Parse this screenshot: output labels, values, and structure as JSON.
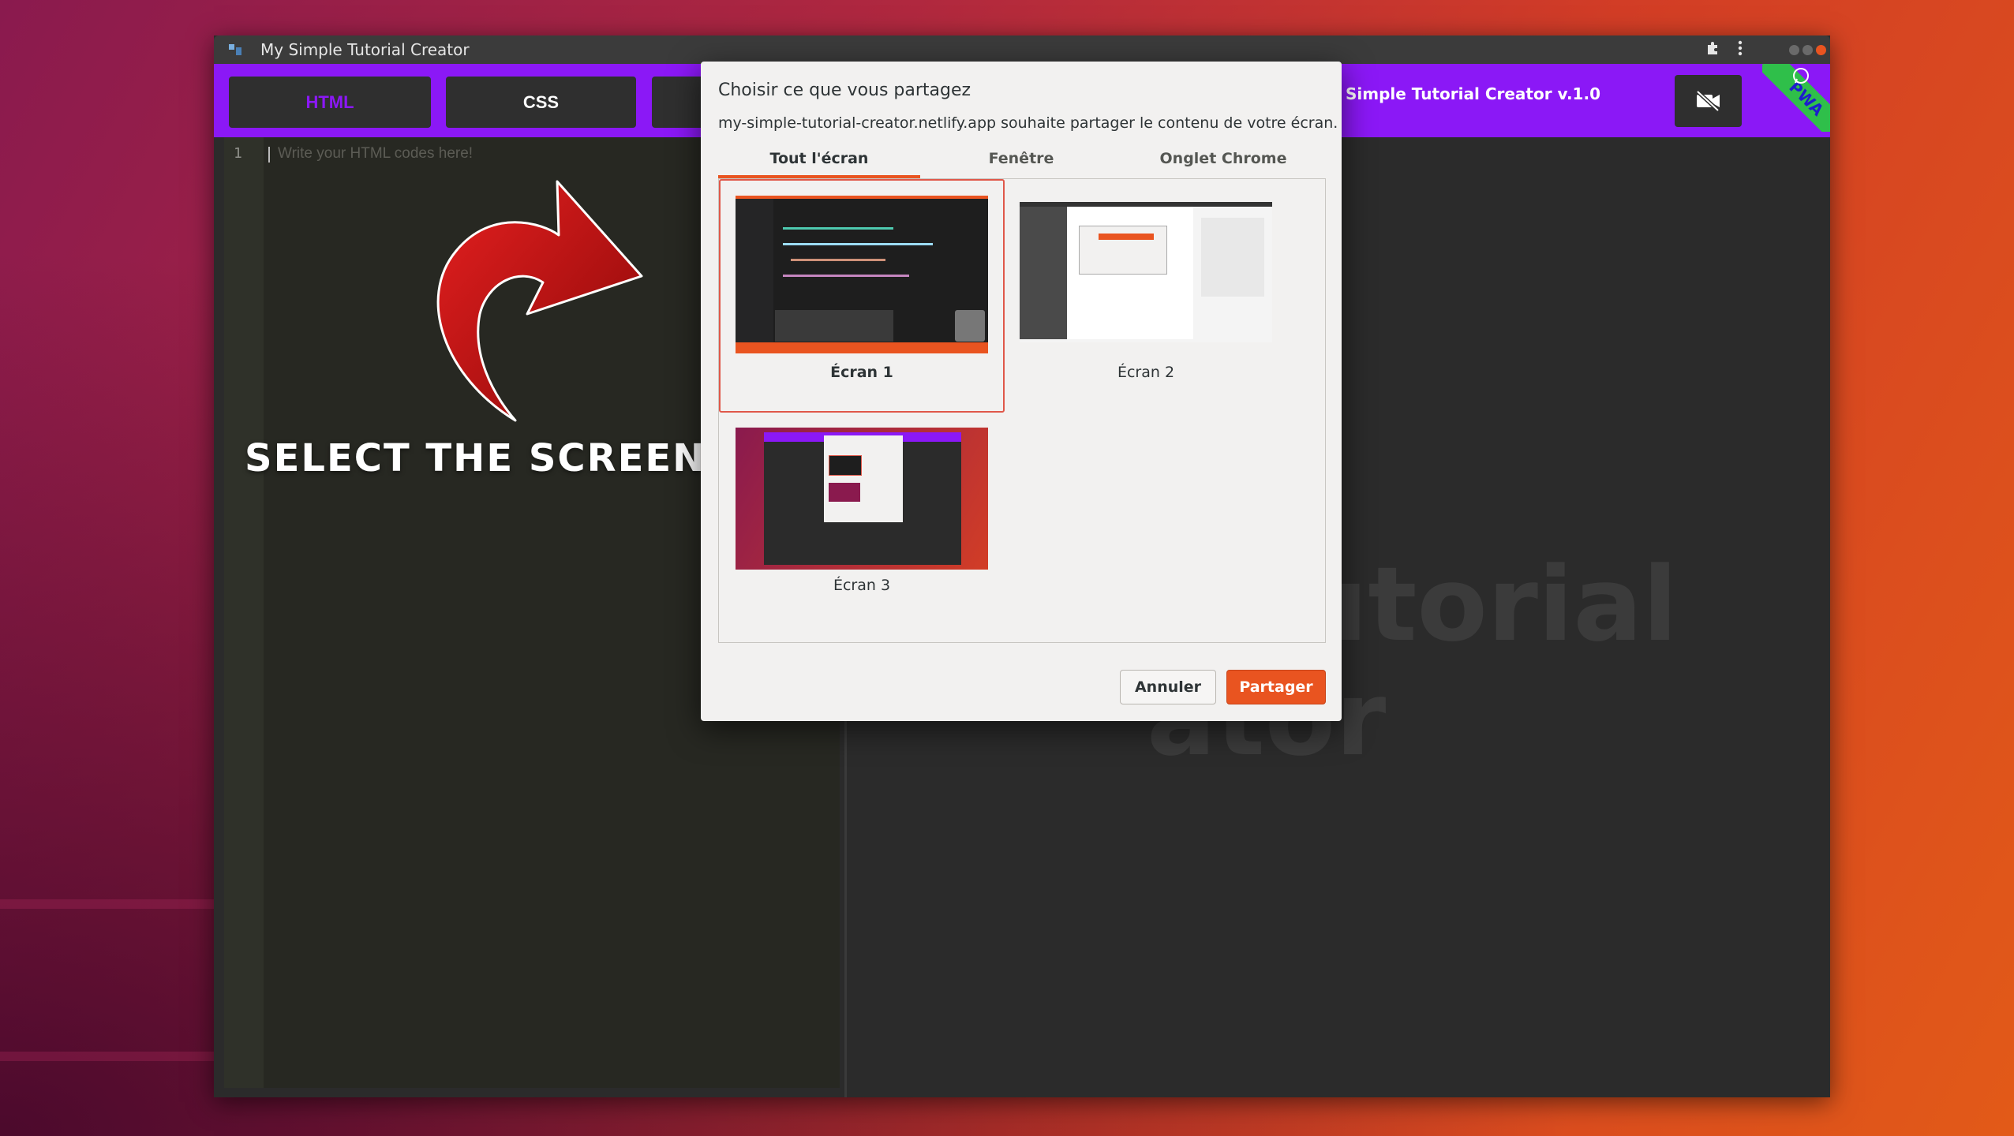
{
  "window": {
    "title": "My Simple Tutorial Creator"
  },
  "toolbar": {
    "tabs": [
      {
        "label": "HTML",
        "color": "#8b18f6"
      },
      {
        "label": "CSS",
        "color": "#ffffff"
      }
    ],
    "brand": "Simple Tutorial Creator v.1.0",
    "pwa_badge": "PWA",
    "icons": [
      "app-icon",
      "extensions-icon",
      "kebab-menu-icon",
      "camera-off-icon",
      "whatsapp-icon"
    ]
  },
  "editor": {
    "line_number": "1",
    "placeholder": "Write your HTML codes here!"
  },
  "preview": {
    "watermark_line1": "e Tutorial",
    "watermark_line2": "ator"
  },
  "annotation": {
    "label": "SELECT THE SCREEN"
  },
  "share_dialog": {
    "title": "Choisir ce que vous partagez",
    "description": "my-simple-tutorial-creator.netlify.app souhaite partager le contenu de votre écran.",
    "tabs": [
      {
        "label": "Tout l'écran",
        "active": true
      },
      {
        "label": "Fenêtre",
        "active": false
      },
      {
        "label": "Onglet Chrome",
        "active": false
      }
    ],
    "screens": [
      {
        "label": "Écran 1",
        "selected": true
      },
      {
        "label": "Écran 2",
        "selected": false
      },
      {
        "label": "Écran 3",
        "selected": false
      }
    ],
    "cancel_label": "Annuler",
    "share_label": "Partager"
  },
  "colors": {
    "accent": "#e95420",
    "toolbar": "#8b18f6",
    "editor_bg": "#272822"
  }
}
